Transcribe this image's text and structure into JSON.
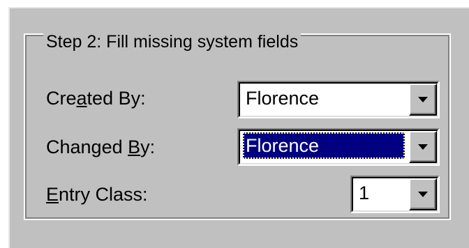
{
  "group": {
    "title": "Step 2:  Fill missing system fields"
  },
  "fields": {
    "created_by": {
      "label_pre": "Cre",
      "label_accel": "a",
      "label_post": "ted By:",
      "value": "Florence"
    },
    "changed_by": {
      "label_pre": "Changed ",
      "label_accel": "B",
      "label_post": "y:",
      "value": "Florence"
    },
    "entry_class": {
      "label_pre": "",
      "label_accel": "E",
      "label_post": "ntry Class:",
      "value": "1"
    }
  },
  "colors": {
    "dialog_bg": "#c0c0c0",
    "selection_bg": "#000080",
    "selection_text": "#ffffff"
  },
  "icons": {
    "dropdown": "chevron-down-icon"
  }
}
